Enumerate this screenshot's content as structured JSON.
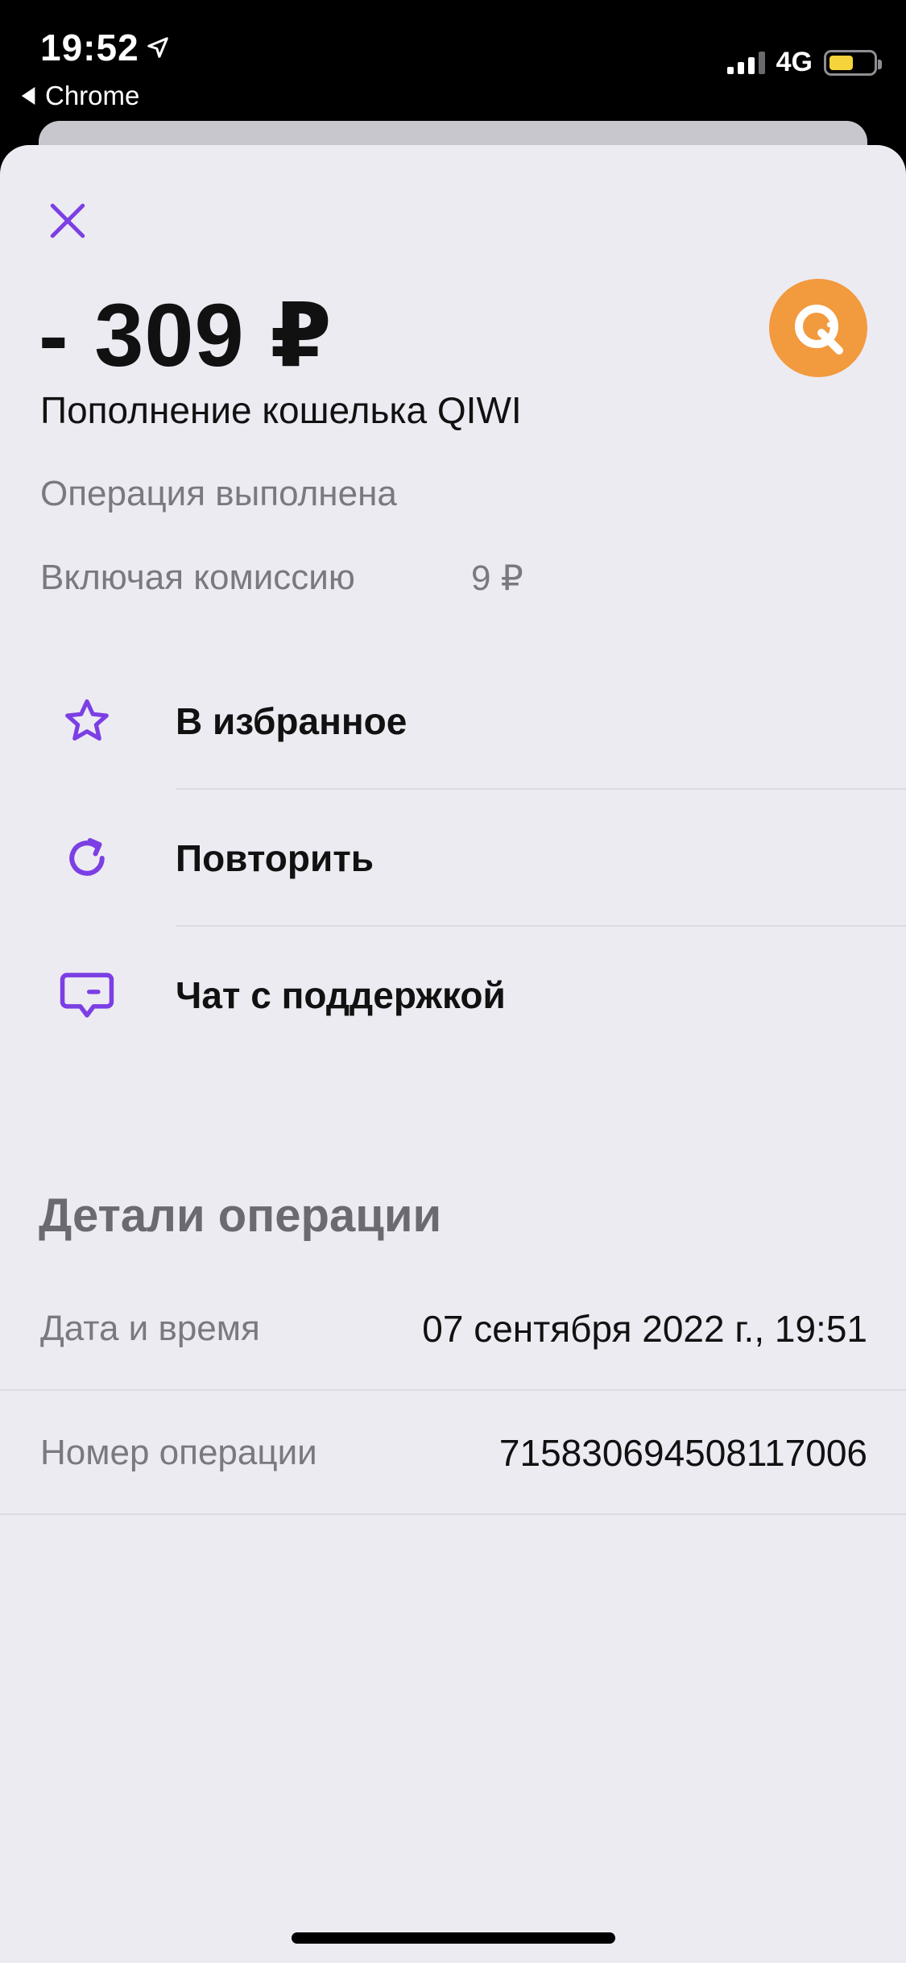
{
  "status_bar": {
    "time": "19:52",
    "back_app": "Chrome",
    "network": "4G"
  },
  "operation": {
    "amount": "- 309 ₽",
    "title": "Пополнение кошелька QIWI",
    "status": "Операция выполнена",
    "fee_label": "Включая комиссию",
    "fee_value": "9 ₽"
  },
  "actions": [
    {
      "label": "В избранное",
      "icon": "star-icon"
    },
    {
      "label": "Повторить",
      "icon": "refresh-icon"
    },
    {
      "label": "Чат с поддержкой",
      "icon": "chat-icon"
    }
  ],
  "details": {
    "heading": "Детали операции",
    "rows": [
      {
        "label": "Дата и время",
        "value": "07 сентября 2022 г., 19:51"
      },
      {
        "label": "Номер операции",
        "value": "715830694508117006"
      }
    ]
  },
  "colors": {
    "accent": "#7b3fe4",
    "logo": "#f19a3e",
    "sheet_bg": "#edebf2"
  }
}
